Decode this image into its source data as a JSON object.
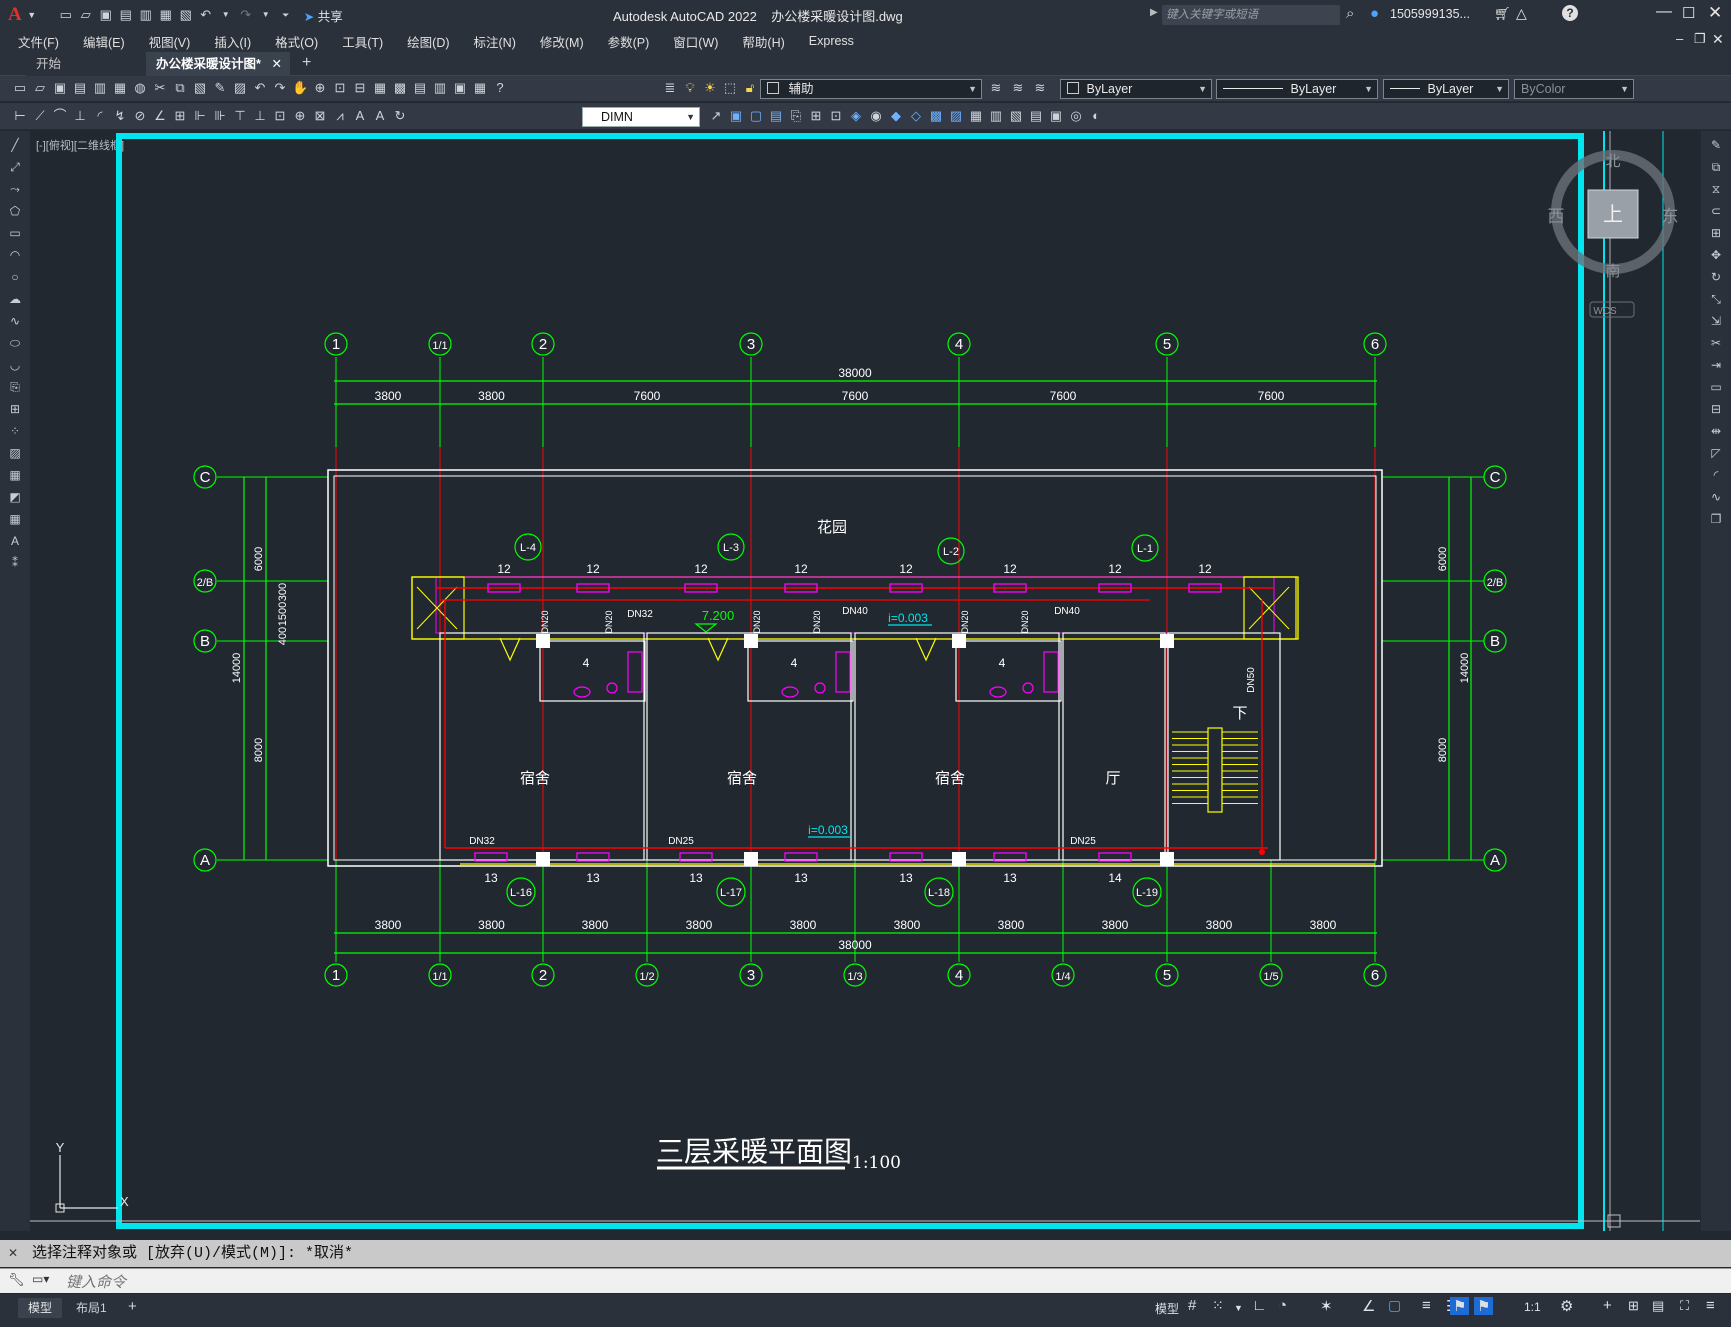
{
  "title_bar": {
    "app_title": "Autodesk AutoCAD 2022",
    "file_name": "办公楼采暖设计图.dwg",
    "share_label": "共享",
    "search_placeholder": "键入关键字或短语",
    "user_name": "1505999135..."
  },
  "menu": [
    "文件(F)",
    "编辑(E)",
    "视图(V)",
    "插入(I)",
    "格式(O)",
    "工具(T)",
    "绘图(D)",
    "标注(N)",
    "修改(M)",
    "参数(P)",
    "窗口(W)",
    "帮助(H)",
    "Express"
  ],
  "tabs": {
    "start": "开始",
    "active": "办公楼采暖设计图*"
  },
  "toolbar": {
    "layer_name": "辅助",
    "color": "ByLayer",
    "linetype": "ByLayer",
    "lineweight": "ByLayer",
    "plotstyle": "ByColor",
    "dim_style": "DIMN"
  },
  "viewport_label": "[-][俯视][二维线框]",
  "viewcube": {
    "north": "北",
    "south": "南",
    "east": "东",
    "west": "西",
    "top": "上",
    "wcs": "WCS"
  },
  "ucs": {
    "y": "Y",
    "x": "X"
  },
  "drawing": {
    "title": "三层采暖平面图",
    "scale": "1:100",
    "grid_top": [
      "1",
      "1/1",
      "2",
      "3",
      "4",
      "5",
      "6"
    ],
    "grid_bottom": [
      "1",
      "1/1",
      "2",
      "1/2",
      "3",
      "1/3",
      "4",
      "1/4",
      "5",
      "1/5",
      "6"
    ],
    "grid_rows": [
      "C",
      "2/B",
      "B",
      "A"
    ],
    "dims_top_total": "38000",
    "dims_top": [
      "3800",
      "3800",
      "7600",
      "7600",
      "7600",
      "7600"
    ],
    "dims_bottom_total": "38000",
    "dims_bottom": [
      "3800",
      "3800",
      "3800",
      "3800",
      "3800",
      "3800",
      "3800",
      "3800",
      "3800",
      "3800"
    ],
    "dims_left": [
      "6000",
      "300",
      "1500",
      "400",
      "8000",
      "14000"
    ],
    "dims_right": [
      "6000",
      "8000",
      "14000"
    ],
    "rooms": {
      "garden": "花园",
      "dorm": "宿舍",
      "hall": "厅",
      "stair_down": "下"
    },
    "risers_top": [
      "L-4",
      "L-3",
      "L-2",
      "L-1"
    ],
    "risers_bottom": [
      "L-16",
      "L-17",
      "L-18",
      "L-19"
    ],
    "radiators_top": [
      "12",
      "12",
      "12",
      "12",
      "12",
      "12",
      "12",
      "12"
    ],
    "radiators_bottom": [
      "13",
      "13",
      "13",
      "13",
      "13",
      "13",
      "14"
    ],
    "room_counts": [
      "4",
      "4",
      "4"
    ],
    "pipe_labels": {
      "dn32_a": "DN32",
      "dn20": "DN20",
      "dn40_a": "DN40",
      "dn40_b": "DN40",
      "dn32_b": "DN32",
      "dn25_a": "DN25",
      "dn25_b": "DN25",
      "dn50": "DN50"
    },
    "elevation": "7.200",
    "slope_top": "i=0.003",
    "slope_bottom": "i=0.003"
  },
  "command": {
    "history": "选择注释对象或 [放弃(U)/模式(M)]: *取消*",
    "placeholder": "键入命令"
  },
  "layout_tabs": [
    "模型",
    "布局1"
  ],
  "status": {
    "model": "模型",
    "scale": "1:1"
  },
  "colors": {
    "grid_green": "#00ff00",
    "wall_white": "#ffffff",
    "pipe_red": "#ff0000",
    "radiator_magenta": "#ff00ff",
    "cyan_frame": "#00e5ee",
    "background": "#212830"
  }
}
